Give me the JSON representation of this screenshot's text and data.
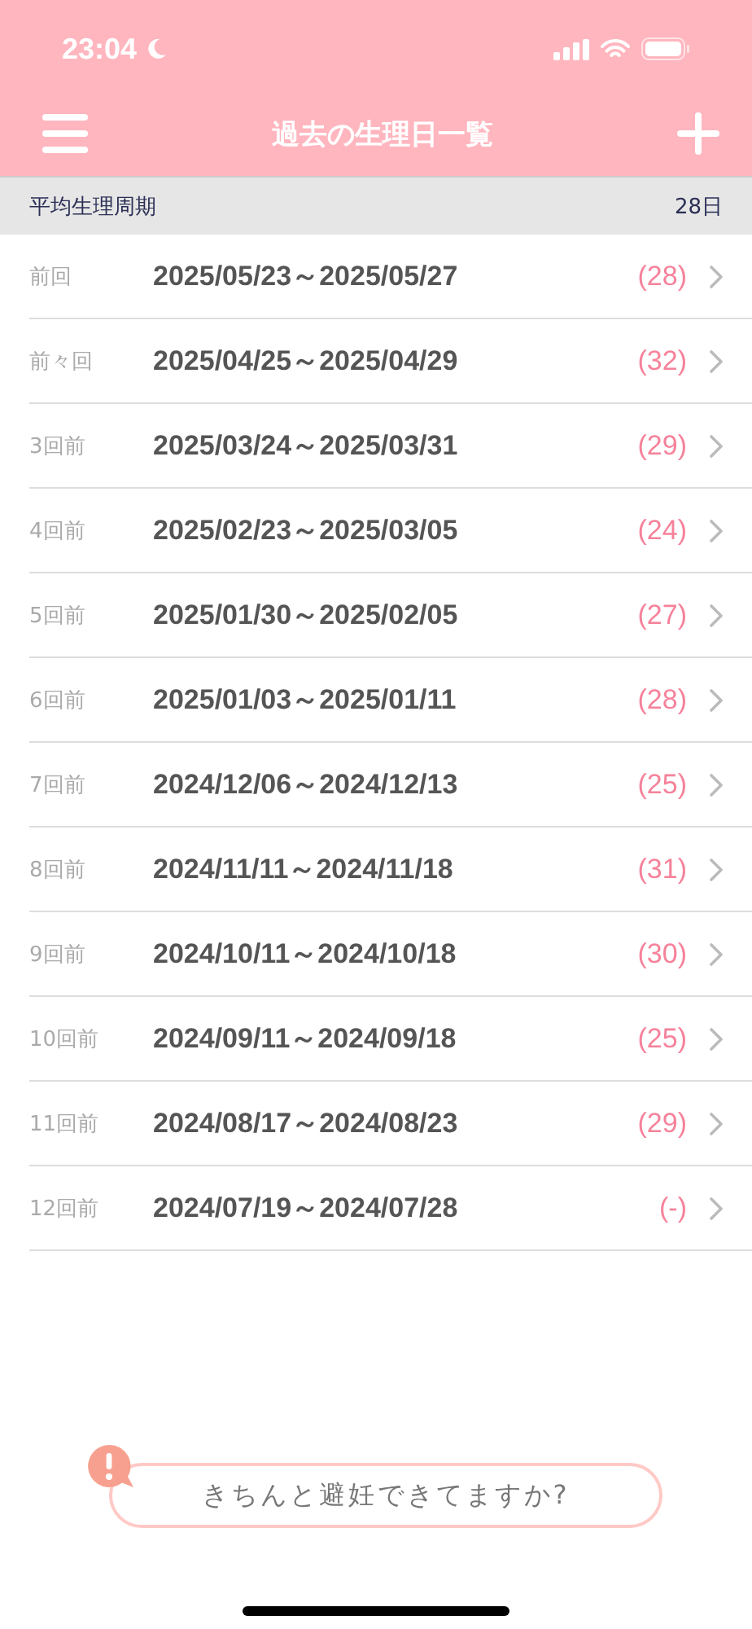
{
  "status_bar": {
    "time": "23:04"
  },
  "nav": {
    "title": "過去の生理日一覧"
  },
  "summary": {
    "label": "平均生理周期",
    "value": "28日"
  },
  "periods": [
    {
      "label": "前回",
      "range": "2025/05/23～2025/05/27",
      "cycle": "(28)"
    },
    {
      "label": "前々回",
      "range": "2025/04/25～2025/04/29",
      "cycle": "(32)"
    },
    {
      "label": "3回前",
      "range": "2025/03/24～2025/03/31",
      "cycle": "(29)"
    },
    {
      "label": "4回前",
      "range": "2025/02/23～2025/03/05",
      "cycle": "(24)"
    },
    {
      "label": "5回前",
      "range": "2025/01/30～2025/02/05",
      "cycle": "(27)"
    },
    {
      "label": "6回前",
      "range": "2025/01/03～2025/01/11",
      "cycle": "(28)"
    },
    {
      "label": "7回前",
      "range": "2024/12/06～2024/12/13",
      "cycle": "(25)"
    },
    {
      "label": "8回前",
      "range": "2024/11/11～2024/11/18",
      "cycle": "(31)"
    },
    {
      "label": "9回前",
      "range": "2024/10/11～2024/10/18",
      "cycle": "(30)"
    },
    {
      "label": "10回前",
      "range": "2024/09/11～2024/09/18",
      "cycle": "(25)"
    },
    {
      "label": "11回前",
      "range": "2024/08/17～2024/08/23",
      "cycle": "(29)"
    },
    {
      "label": "12回前",
      "range": "2024/07/19～2024/07/28",
      "cycle": "(-)"
    }
  ],
  "banner": {
    "text": "きちんと避妊できてますか?"
  }
}
